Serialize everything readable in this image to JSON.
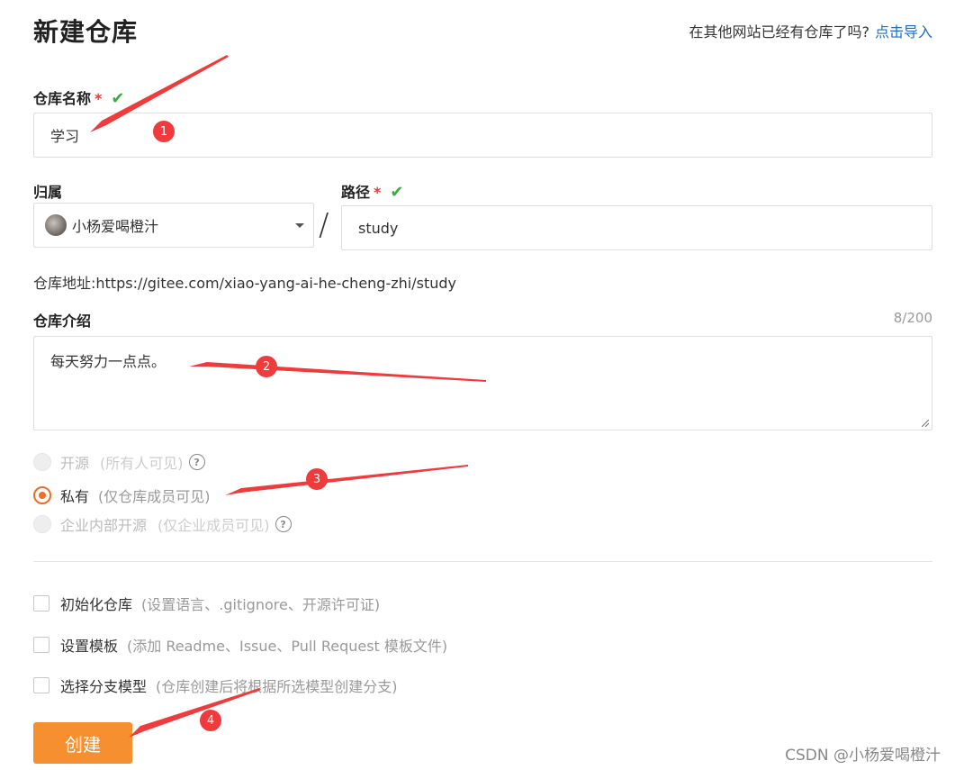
{
  "header": {
    "title": "新建仓库",
    "import_prompt": "在其他网站已经有仓库了吗?",
    "import_link": "点击导入"
  },
  "repo_name": {
    "label": "仓库名称",
    "required_mark": "*",
    "valid_icon": "check-icon",
    "value": "学习"
  },
  "owner": {
    "label": "归属",
    "value": "小杨爱喝橙汁"
  },
  "path": {
    "label": "路径",
    "required_mark": "*",
    "separator": "/",
    "value": "study"
  },
  "repo_address": {
    "text": "仓库地址:https://gitee.com/xiao-yang-ai-he-cheng-zhi/study"
  },
  "description": {
    "label": "仓库介绍",
    "counter": "8/200",
    "value": "每天努力一点点。"
  },
  "visibility": [
    {
      "label": "开源",
      "hint": "(所有人可见)",
      "checked": false,
      "disabled": true,
      "help_icon": true
    },
    {
      "label": "私有",
      "hint": "(仅仓库成员可见)",
      "checked": true,
      "disabled": false,
      "help_icon": false
    },
    {
      "label": "企业内部开源",
      "hint": "(仅企业成员可见)",
      "checked": false,
      "disabled": true,
      "help_icon": true
    }
  ],
  "options": [
    {
      "label": "初始化仓库",
      "hint": "(设置语言、.gitignore、开源许可证)",
      "checked": false
    },
    {
      "label": "设置模板",
      "hint": "(添加 Readme、Issue、Pull Request 模板文件)",
      "checked": false
    },
    {
      "label": "选择分支模型",
      "hint": "(仓库创建后将根据所选模型创建分支)",
      "checked": false
    }
  ],
  "submit": {
    "label": "创建"
  },
  "annotations": [
    "1",
    "2",
    "3",
    "4"
  ],
  "watermark": "CSDN @小杨爱喝橙汁",
  "colors": {
    "accent": "#f36b24",
    "button": "#f58f2f",
    "link": "#1d6fbd",
    "valid": "#3bab43",
    "annotation": "#ef3b3b"
  }
}
